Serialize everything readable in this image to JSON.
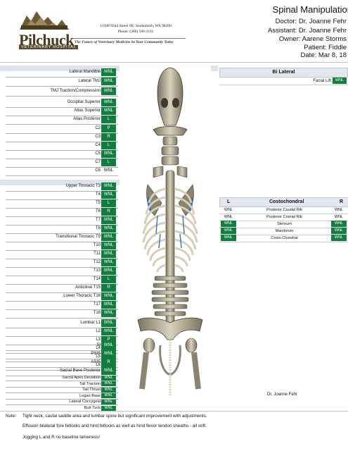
{
  "clinic": {
    "name": "Pilchuck",
    "subtitle": "VETERINARY HOSPITAL",
    "address_line1": "11308 92nd Street SE, Snohomish, WA 98290",
    "address_line2": "Phone: (360) 568-3111",
    "tagline": "The Future of Veterinary Medicine In Your Community Today"
  },
  "header": {
    "title": "Spinal Manipulation",
    "doctor": "Doctor: Dr. Joanne Fehr",
    "assistant": "Assistant: Dr. Joanne Fehr",
    "owner": "Owner: Aarene Storms",
    "patient": "Patient: Fiddle",
    "date": "Date: Mar 8, 18"
  },
  "left_rows": [
    {
      "label": "Lateral Mandible",
      "value": "WNL"
    },
    {
      "label": "Lateral TMJ",
      "value": "WNL"
    },
    {
      "label": "TMJ Traction/Compression",
      "value": "WNL"
    },
    {
      "label": "Occipital Superior",
      "value": "WNL"
    },
    {
      "label": "Atlas Superior",
      "value": "WNL"
    },
    {
      "label": "Atlas Posterior",
      "value": "L"
    },
    {
      "label": "C2",
      "value": "P"
    },
    {
      "label": "C3",
      "value": "R"
    },
    {
      "label": "C4",
      "value": "L"
    },
    {
      "label": "C5",
      "value": "WNL"
    },
    {
      "label": "C7",
      "value": "L"
    },
    {
      "label": "C6",
      "value": "WNL"
    },
    {
      "label": "Upper Thoracic T3",
      "value": "WNL"
    },
    {
      "label": "T4",
      "value": "WNL"
    },
    {
      "label": "T5",
      "value": "L"
    },
    {
      "label": "T6",
      "value": "R"
    },
    {
      "label": "T7",
      "value": "WNL"
    },
    {
      "label": "T8",
      "value": "WNL"
    },
    {
      "label": "Transitional Thoracic T9",
      "value": "WNL"
    },
    {
      "label": "T10",
      "value": "WNL"
    },
    {
      "label": "T11",
      "value": "WNL"
    },
    {
      "label": "T12",
      "value": "WNL"
    },
    {
      "label": "T13",
      "value": "WNL"
    },
    {
      "label": "T14",
      "value": "L"
    },
    {
      "label": "Anticlinal T15",
      "value": "R"
    },
    {
      "label": "Lower Thoracic T16",
      "value": "WNL"
    },
    {
      "label": "T17",
      "value": "WNL"
    },
    {
      "label": "T18",
      "value": "WNL"
    },
    {
      "label": "Lumbar L1",
      "value": "WNL"
    },
    {
      "label": "L2",
      "value": "WNL"
    },
    {
      "label": "L3",
      "value": "P"
    },
    {
      "label": "L4",
      "value": "L"
    },
    {
      "label": "L5",
      "value": "R"
    },
    {
      "label": "L6",
      "value": "WNL"
    },
    {
      "label": "SI",
      "value": "WNL"
    },
    {
      "label": "PSIS",
      "value": "WNL"
    },
    {
      "label": "ASIS",
      "value": "R"
    },
    {
      "label": "Sacral Base Posterior",
      "value": "WNL"
    },
    {
      "label": "Sacral Apex Deviation",
      "value": "WNL"
    },
    {
      "label": "Tail Traction",
      "value": "WNL"
    },
    {
      "label": "Tail Thrust",
      "value": "WNL"
    },
    {
      "label": "Logan Base",
      "value": "WNL"
    },
    {
      "label": "Lateral Coccygeal",
      "value": "WNL"
    },
    {
      "label": "Butt Tuck",
      "value": "WNL"
    }
  ],
  "bilateral": {
    "header": "Bi Lateral",
    "rows": [
      {
        "label": "Facial Lift",
        "value": "WNL"
      }
    ]
  },
  "costochondral": {
    "header_left": "L",
    "header_mid": "Costochondral",
    "header_right": "R",
    "rows": [
      {
        "left": "WNL",
        "label": "Posterior Caudal Rib",
        "right": "WNL"
      },
      {
        "left": "WNL",
        "label": "Posterior Cranial Rib",
        "right": "WNL"
      },
      {
        "left": "WNL",
        "label": "Sternum",
        "right": "WNL"
      },
      {
        "left": "WNL",
        "label": "Manibrium",
        "right": "WNL"
      },
      {
        "left": "WNL",
        "label": "Costo Chondral",
        "right": "WNL"
      }
    ]
  },
  "signature": "Dr. Joanne Fehr",
  "notes": {
    "prefix": "Note:",
    "line1": "Tight neck, cautal saddle area and lumbar spine but significant improvement with adjustments.",
    "line2": "Effusion bilateral fore fetlocks and hind fetlocks as well as hind flexor tendon sheaths - all soft.",
    "line3": "Jogging L and R no baseline lameness!"
  },
  "colors": {
    "wnl_green": "#107e3e",
    "brand_brown": "#5a4a2a",
    "header_band": "#e3e7ef"
  }
}
